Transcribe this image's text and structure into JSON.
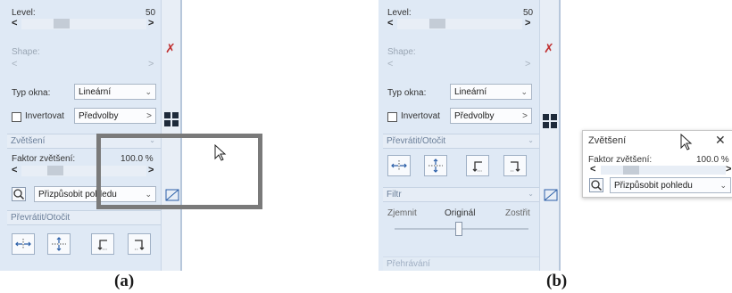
{
  "panel_a": {
    "level_label": "Level:",
    "level_value": "50",
    "shape_label": "Shape:",
    "window_type_label": "Typ okna:",
    "window_type_value": "Lineární",
    "invert_label": "Invertovat",
    "presets_label": "Předvolby",
    "zoom_section": "Zvětšení",
    "zoom_factor_label": "Faktor zvětšení:",
    "zoom_factor_value": "100.0 %",
    "fit_view_value": "Přizpůsobit pohledu",
    "flip_section": "Převrátit/Otočit"
  },
  "panel_b": {
    "level_label": "Level:",
    "level_value": "50",
    "shape_label": "Shape:",
    "window_type_label": "Typ okna:",
    "window_type_value": "Lineární",
    "invert_label": "Invertovat",
    "presets_label": "Předvolby",
    "flip_section": "Převrátit/Otočit",
    "filter_section": "Filtr",
    "soften_label": "Zjemnit",
    "original_label": "Originál",
    "sharpen_label": "Zostřit",
    "next_section": "Přehrávání"
  },
  "float_window": {
    "title": "Zvětšení",
    "zoom_factor_label": "Faktor zvětšení:",
    "zoom_factor_value": "100.0 %",
    "fit_view_value": "Přizpůsobit pohledu"
  },
  "captions": {
    "a": "(a)",
    "b": "(b)"
  },
  "icons": {
    "flip_horizontal": "flip-horizontal-icon",
    "flip_vertical": "flip-vertical-icon",
    "rotate_left": "rotate-left-icon",
    "rotate_right": "rotate-right-icon",
    "zoom": "magnifier-icon",
    "close": "close-icon",
    "cursor": "mouse-cursor-icon"
  }
}
